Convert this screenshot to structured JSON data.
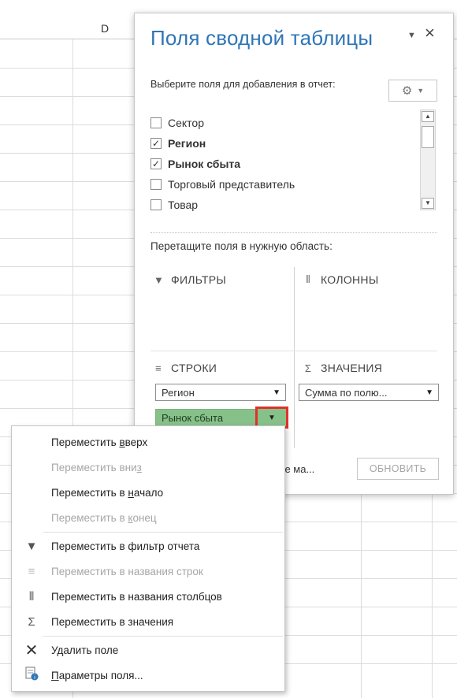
{
  "sheet": {
    "column_label": "D"
  },
  "pane": {
    "title": "Поля сводной таблицы",
    "instruction": "Выберите поля для добавления в отчет:",
    "fields": [
      {
        "label": "Сектор",
        "checked": false
      },
      {
        "label": "Регион",
        "checked": true
      },
      {
        "label": "Рынок сбыта",
        "checked": true
      },
      {
        "label": "Торговый представитель",
        "checked": false
      },
      {
        "label": "Товар",
        "checked": false
      }
    ],
    "drag_label": "Перетащите поля в нужную область:",
    "areas": {
      "filters": "ФИЛЬТРЫ",
      "columns": "КОЛОННЫ",
      "rows": "СТРОКИ",
      "values": "ЗНАЧЕНИЯ"
    },
    "rows_fields": [
      "Регион",
      "Рынок сбыта"
    ],
    "values_fields": [
      "Сумма по полю..."
    ],
    "defer_text": "ние ма...",
    "update_label": "ОБНОВИТЬ"
  },
  "menu": {
    "move_up": {
      "before": "Переместить ",
      "ul": "в",
      "after": "верх"
    },
    "move_down": {
      "before": "Переместить вни",
      "ul": "з",
      "after": ""
    },
    "move_start": {
      "before": "Переместить в ",
      "ul": "н",
      "after": "ачало"
    },
    "move_end": {
      "before": "Переместить в ",
      "ul": "к",
      "after": "онец"
    },
    "to_filter": "Переместить в фильтр отчета",
    "to_rows": "Переместить в названия строк",
    "to_columns": "Переместить в названия столбцов",
    "to_values": "Переместить в значения",
    "delete": "Удалить поле",
    "settings": {
      "before": "",
      "ul": "П",
      "after": "араметры поля..."
    }
  }
}
